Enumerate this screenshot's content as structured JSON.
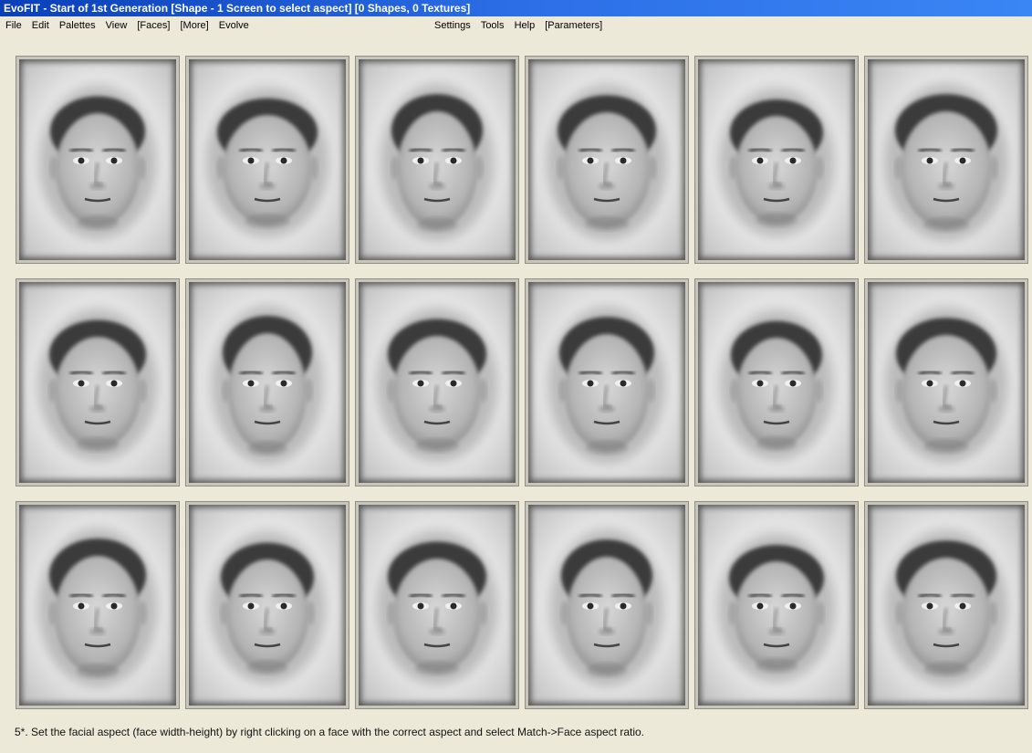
{
  "window": {
    "title": "EvoFIT - Start of 1st Generation [Shape - 1 Screen to select aspect] [0 Shapes, 0 Textures]"
  },
  "menu": {
    "left": [
      "File",
      "Edit",
      "Palettes",
      "View",
      "[Faces]",
      "[More]",
      "Evolve"
    ],
    "right": [
      "Settings",
      "Tools",
      "Help",
      "[Parameters]"
    ]
  },
  "faces": {
    "rows": 3,
    "columns": 6,
    "count": 18
  },
  "status": {
    "instruction": "5*. Set the facial aspect (face width-height) by right clicking on a face with the correct aspect and select Match->Face aspect ratio."
  },
  "colors": {
    "title_start": "#0a3fb8",
    "title_end": "#3a86f5",
    "window_bg": "#ece9d8"
  }
}
